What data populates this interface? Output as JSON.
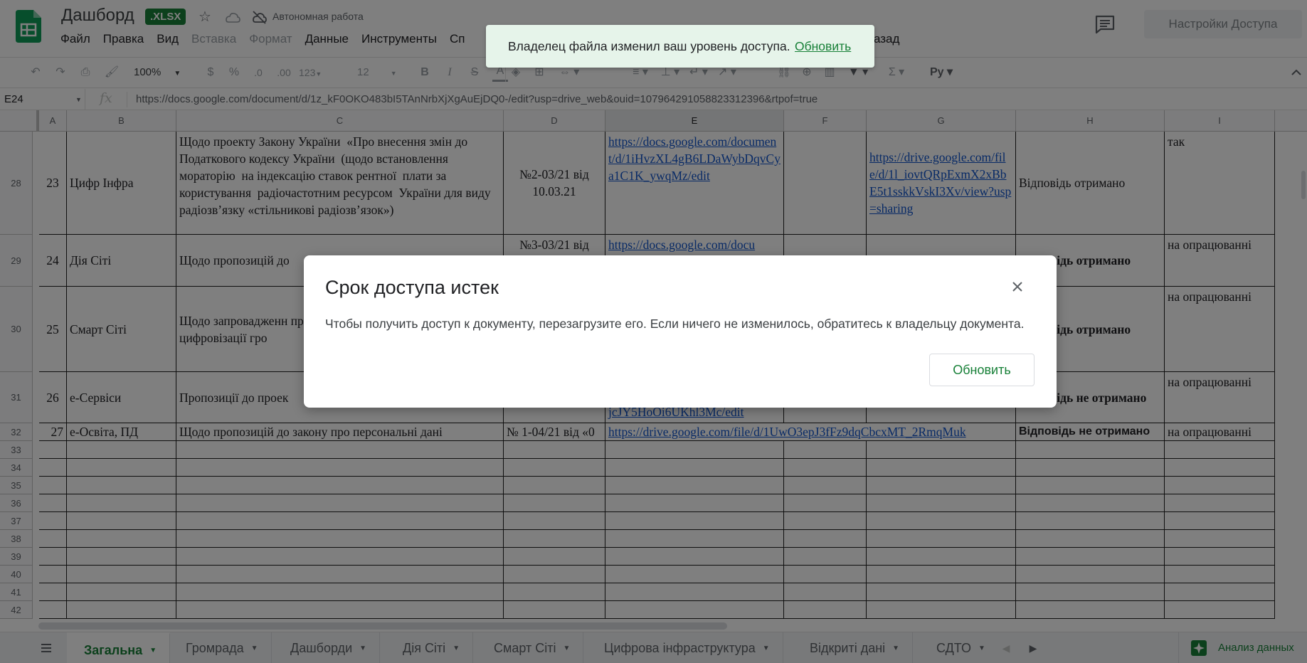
{
  "header": {
    "title": "Дашборд",
    "badge": ".XLSX",
    "offline_label": "Автономная работа",
    "share_label": "Настройки Доступа",
    "menu": [
      {
        "label": "Файл",
        "enabled": true
      },
      {
        "label": "Правка",
        "enabled": true
      },
      {
        "label": "Вид",
        "enabled": true
      },
      {
        "label": "Вставка",
        "enabled": false
      },
      {
        "label": "Формат",
        "enabled": false
      },
      {
        "label": "Данные",
        "enabled": true
      },
      {
        "label": "Инструменты",
        "enabled": true
      },
      {
        "label": "Сп",
        "enabled": true
      }
    ],
    "menu_tail": "азад"
  },
  "toolbar": {
    "zoom": "100%",
    "currency": "$",
    "percent": "%",
    "decrease_decimals": ".0",
    "increase_decimals": ".00",
    "more_formats": "123",
    "font_size": "12"
  },
  "formula_bar": {
    "cell_ref": "E24",
    "fx": "fx",
    "value": "https://docs.google.com/document/d/1z_kF0OKO483bI5TAnNrbXjXgAuEjDQ0-/edit?usp=drive_web&ouid=107964291058823312396&rtpof=true"
  },
  "grid": {
    "columns": [
      "A",
      "B",
      "C",
      "D",
      "E",
      "F",
      "G",
      "H",
      "I"
    ],
    "selected_column": "E",
    "rows": [
      {
        "num": "28",
        "a": "23",
        "b": "Цифр Інфра",
        "c": "Щодо проекту Закону України  «Про внесення змін до  Податкового кодексу України  (щодо встановлення мораторію  на індексацію ставок рентної  плати за користування  радіочастотним ресурсом  України для виду радіозв’язку «стільникові радіозв’язок»)",
        "d": "№2-03/21 від 10.03.21",
        "e": "https://docs.google.com/document/d/1iHvzXL4gB6LDaWybDqvCya1C1K_ywqMz/edit",
        "f": "",
        "g": "https://drive.google.com/file/d/1l_iovtQRpExmX2xBbE5t1sskkVskI3Xv/view?usp=sharing",
        "h": "Відповідь отримано",
        "i": "так"
      },
      {
        "num": "29",
        "a": "24",
        "b": "Дія Сіті",
        "c": "Щодо пропозицій до",
        "d": "№3-03/21 від",
        "e": "https://docs.google.com/docu",
        "f": "",
        "g": "",
        "h": "Відповідь отримано",
        "i": "на опрацюванні"
      },
      {
        "num": "30",
        "a": "25",
        "b": "Смарт Сіті",
        "c": "Щодо запровадженн при цифровізації гро",
        "d": "",
        "e": "",
        "f": "",
        "g": "",
        "h": "Відповідь отримано",
        "i": "на опрацюванні"
      },
      {
        "num": "31",
        "a": "26",
        "b": "е-Сервіси",
        "c": "Пропозиції до проек",
        "d": "",
        "e": "jcJY5HoOi6UKhl3Mc/edit",
        "f": "",
        "g": "",
        "h": "Відповідь не отримано",
        "i": "на опрацюванні"
      },
      {
        "num": "32",
        "a": "27",
        "b": "е-Освіта, ПД",
        "c": "Щодо пропозицій до закону про персональні дані",
        "d": "№ 1-04/21 від «0",
        "e": "https://drive.google.com/file/d/1UwO3epJ3fFz9dqCbcxMT_2RmqMuk",
        "f": "",
        "g": "",
        "h": "Відповідь не отримано",
        "i": "на опрацюванні"
      }
    ],
    "empty_rows": [
      "33",
      "34",
      "35",
      "36",
      "37",
      "38",
      "39",
      "40",
      "41",
      "42"
    ]
  },
  "sheets": {
    "tabs": [
      "Загальна",
      "Громрада",
      "Дашборди",
      "Дія Сіті",
      "Смарт Сіті",
      "Цифрова інфраструктура",
      "Відкриті дані",
      "СДТО"
    ],
    "active": "Загальна",
    "explore_label": "Анализ данных"
  },
  "toast": {
    "message": "Владелец файла изменил ваш уровень доступа.",
    "action": "Обновить"
  },
  "dialog": {
    "title": "Срок доступа истек",
    "message": "Чтобы получить доступ к документу, перезагрузите его. Если ничего не изменилось, обратитесь к владельцу документа.",
    "button": "Обновить"
  },
  "colors": {
    "brand_green": "#188038",
    "link_blue": "#1155cc",
    "toast_bg": "#e6f4ea",
    "overlay": "rgba(0,0,0,0.5)"
  }
}
